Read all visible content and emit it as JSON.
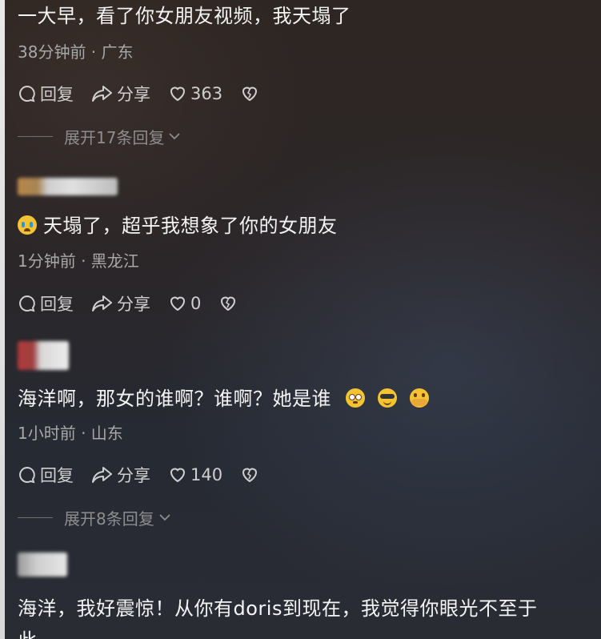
{
  "comments": [
    {
      "text": "一大早，看了你女朋友视频，我天塌了",
      "meta": "38分钟前 · 广东",
      "reply_label": "回复",
      "share_label": "分享",
      "likes": "363",
      "expand": "展开17条回复"
    },
    {
      "text": "天塌了，超乎我想象了你的女朋友",
      "meta": "1分钟前 · 黑龙江",
      "reply_label": "回复",
      "share_label": "分享",
      "likes": "0"
    },
    {
      "text": "海洋啊，那女的谁啊？谁啊？她是谁",
      "meta": "1小时前 · 山东",
      "reply_label": "回复",
      "share_label": "分享",
      "likes": "140",
      "expand": "展开8条回复"
    },
    {
      "text": "海洋，我好震惊！从你有doris到现在，我觉得你眼光不至于",
      "text_cut": "此"
    }
  ],
  "colors": {
    "accent_emoji": "#f4c430"
  },
  "icons": [
    "comment-icon",
    "share-icon",
    "heart-icon",
    "broken-heart-icon",
    "chevron-down-icon",
    "crying-face-emoji",
    "flushed-face-emoji",
    "sunglasses-face-emoji",
    "hands-over-mouth-emoji"
  ]
}
